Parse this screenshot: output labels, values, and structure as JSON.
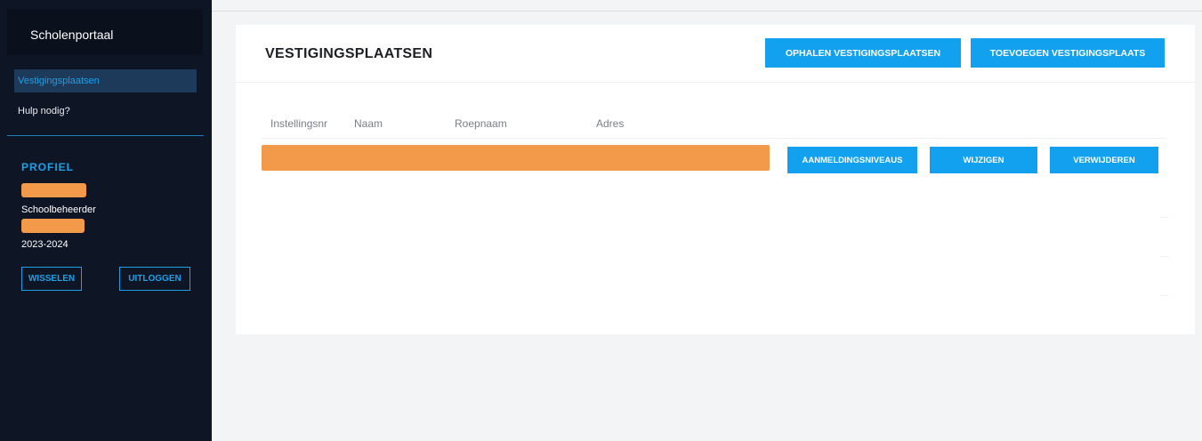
{
  "sidebar": {
    "brand": "Scholenportaal",
    "nav": [
      {
        "label": "Vestigingsplaatsen",
        "active": true
      },
      {
        "label": "Hulp nodig?",
        "active": false
      }
    ],
    "profile": {
      "title": "PROFIEL",
      "role": "Schoolbeheerder",
      "year": "2023-2024",
      "switch_label": "WISSELEN",
      "logout_label": "UITLOGGEN"
    }
  },
  "main": {
    "title": "VESTIGINGSPLAATSEN",
    "fetch_button": "OPHALEN VESTIGINGSPLAATSEN",
    "add_button": "TOEVOEGEN VESTIGINGSPLAATS",
    "table": {
      "columns": [
        "Instellingsnr",
        "Naam",
        "Roepnaam",
        "Adres"
      ],
      "row_actions": {
        "levels": "AANMELDINGSNIVEAUS",
        "edit": "WIJZIGEN",
        "delete": "VERWIJDEREN"
      }
    }
  },
  "colors": {
    "sidebar_bg": "#0e1626",
    "accent": "#12a1ef",
    "redaction": "#f39a4a"
  }
}
